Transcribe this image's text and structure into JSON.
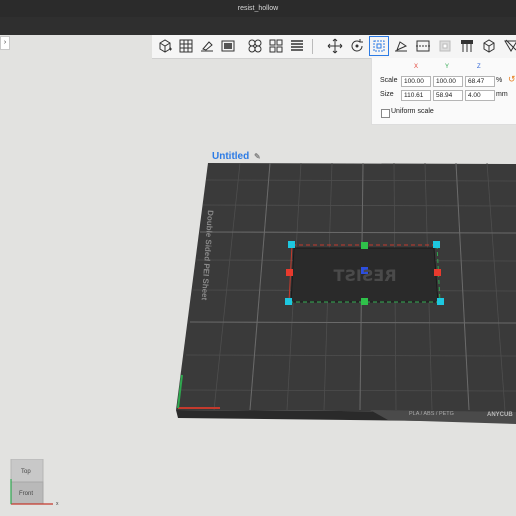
{
  "window": {
    "title": "resist_hollow"
  },
  "sidebar_toggle": {
    "glyph": "›"
  },
  "toolbar": {
    "tools": [
      {
        "name": "add-object-icon"
      },
      {
        "name": "arrange-grid-icon"
      },
      {
        "name": "lay-flat-icon"
      },
      {
        "name": "add-image-icon"
      },
      {
        "name": "split-objects-icon"
      },
      {
        "name": "split-parts-icon"
      },
      {
        "name": "layers-icon"
      },
      {
        "name": "move-icon"
      },
      {
        "name": "rotate-icon"
      },
      {
        "name": "scale-icon"
      },
      {
        "name": "place-on-face-icon"
      },
      {
        "name": "cut-icon"
      },
      {
        "name": "hollow-icon"
      },
      {
        "name": "support-paint-icon"
      },
      {
        "name": "seam-paint-icon"
      },
      {
        "name": "measure-icon"
      }
    ]
  },
  "transform": {
    "axes": {
      "x": "X",
      "y": "Y",
      "z": "Z"
    },
    "axis_colors": {
      "x": "#e03c31",
      "y": "#2fa84f",
      "z": "#2c63d6"
    },
    "scale": {
      "label": "Scale",
      "x": "100.00",
      "y": "100.00",
      "z": "68.47",
      "unit": "%"
    },
    "size": {
      "label": "Size",
      "x": "110.61",
      "y": "58.94",
      "z": "4.00",
      "unit": "mm"
    },
    "uniform": {
      "label": "Uniform scale",
      "checked": false
    }
  },
  "scene": {
    "project_name": "Untitled",
    "bed_label": "Double Sided PEI Sheet",
    "bed_tag": "PLA / ABS / PETG",
    "brand": "ANYCUB",
    "model_text": "RESIST"
  },
  "nav_cube": {
    "top": "Top",
    "front": "Front",
    "axis_x": "x"
  }
}
